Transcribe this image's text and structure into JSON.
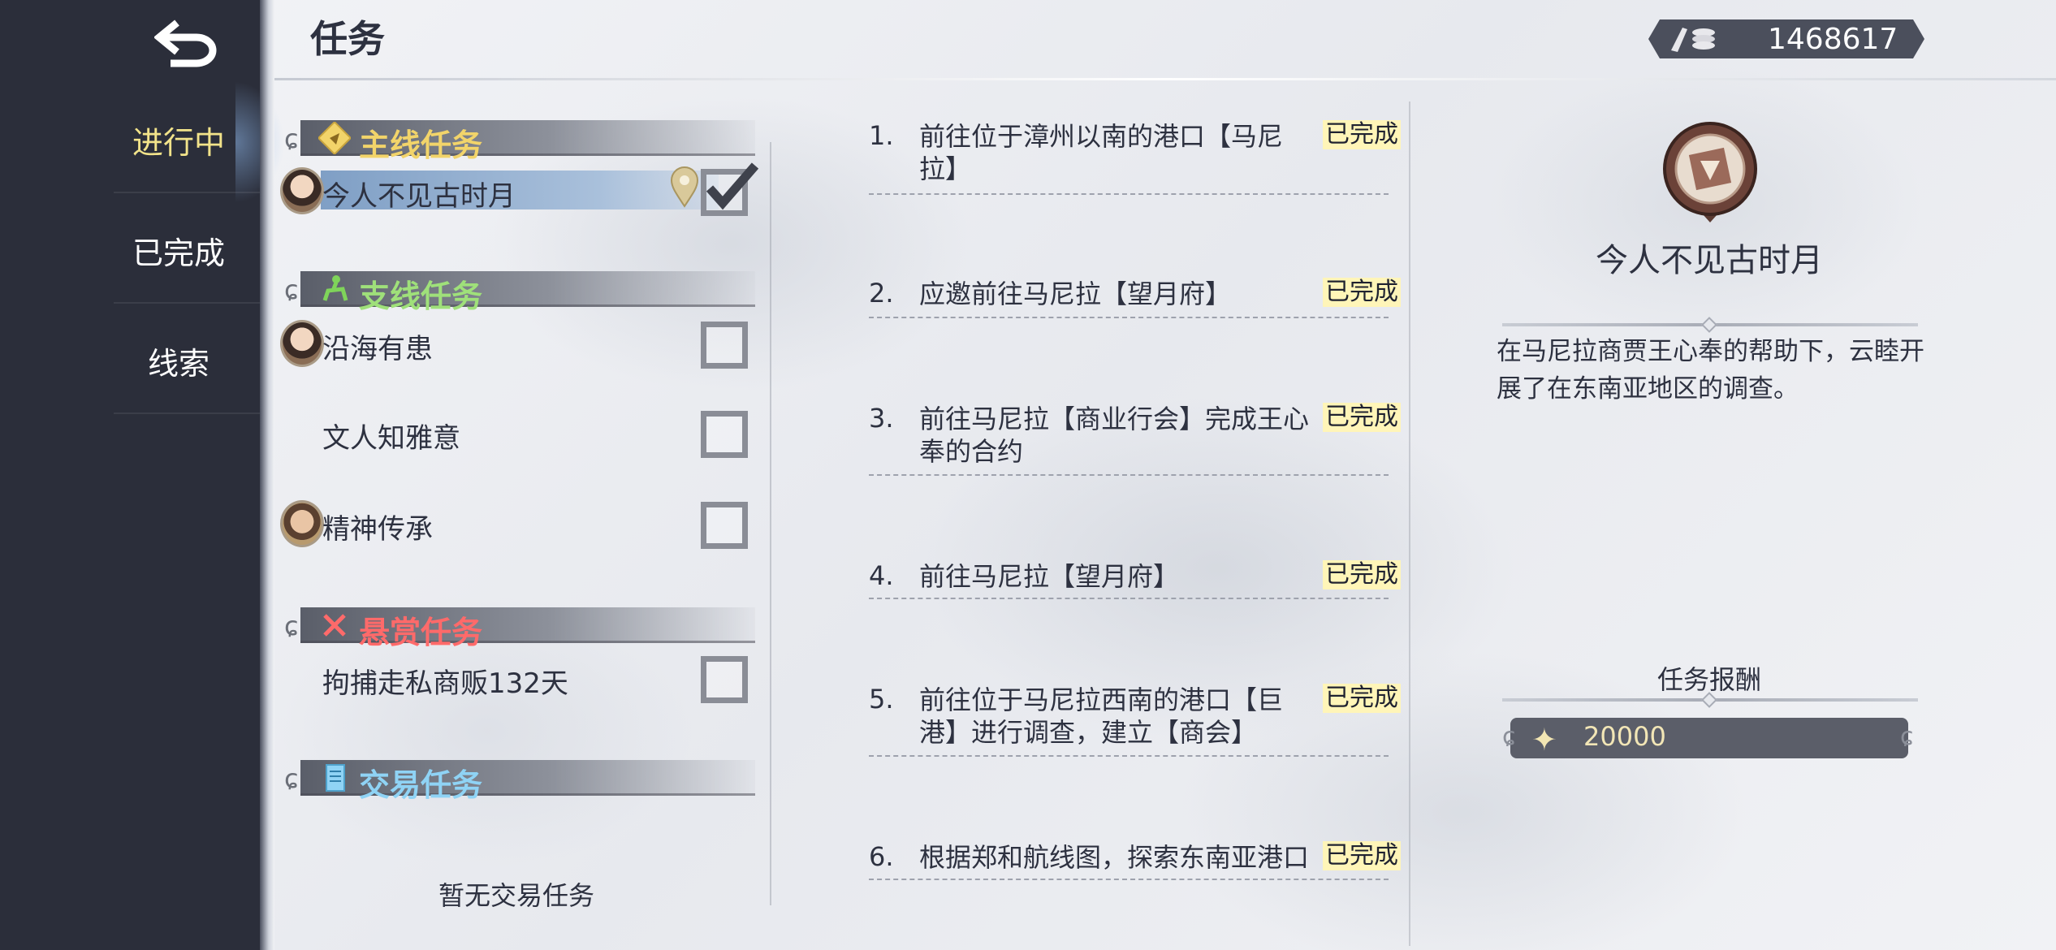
{
  "header": {
    "title": "任务",
    "currency_icon": "coins-icon",
    "currency_value": "1468617"
  },
  "nav": {
    "back_icon": "back-arrow-icon",
    "items": [
      {
        "label": "进行中",
        "active": true
      },
      {
        "label": "已完成",
        "active": false
      },
      {
        "label": "线索",
        "active": false
      }
    ]
  },
  "quest_list": {
    "categories": {
      "main": {
        "label": "主线任务",
        "color": "#f2d46a",
        "icon": "scroll-seal-icon"
      },
      "side": {
        "label": "支线任务",
        "color": "#9fe07a",
        "icon": "horse-rider-icon"
      },
      "bounty": {
        "label": "悬赏任务",
        "color": "#ff6a6a",
        "icon": "crossed-swords-icon"
      },
      "trade": {
        "label": "交易任务",
        "color": "#8fd3f5",
        "icon": "scroll-icon"
      }
    },
    "main_quests": [
      {
        "name": "今人不见古时月",
        "checked": true,
        "selected": true,
        "has_location_pin": true
      }
    ],
    "side_quests": [
      {
        "name": "沿海有患",
        "checked": false
      },
      {
        "name": "文人知雅意",
        "checked": false
      },
      {
        "name": "精神传承",
        "checked": false
      }
    ],
    "bounty_quests": [
      {
        "name": "拘捕走私商贩132天",
        "checked": false
      }
    ],
    "trade_empty_text": "暂无交易任务"
  },
  "steps": [
    {
      "num": "1.",
      "text": "前往位于漳州以南的港口【马尼拉】",
      "status": "已完成"
    },
    {
      "num": "2.",
      "text": "应邀前往马尼拉【望月府】",
      "status": "已完成"
    },
    {
      "num": "3.",
      "text": "前往马尼拉【商业行会】完成王心奉的合约",
      "status": "已完成"
    },
    {
      "num": "4.",
      "text": "前往马尼拉【望月府】",
      "status": "已完成"
    },
    {
      "num": "5.",
      "text": "前往位于马尼拉西南的港口【巨港】进行调查，建立【商会】",
      "status": "已完成"
    },
    {
      "num": "6.",
      "text": "根据郑和航线图，探索东南亚港口",
      "status": "已完成"
    }
  ],
  "detail": {
    "emblem_icon": "quest-emblem-icon",
    "title": "今人不见古时月",
    "description": "在马尼拉商贾王心奉的帮助下，云睦开展了在东南亚地区的调查。",
    "reward_title": "任务报酬",
    "reward_icon": "star-sparkle-icon",
    "reward_value": "20000"
  }
}
